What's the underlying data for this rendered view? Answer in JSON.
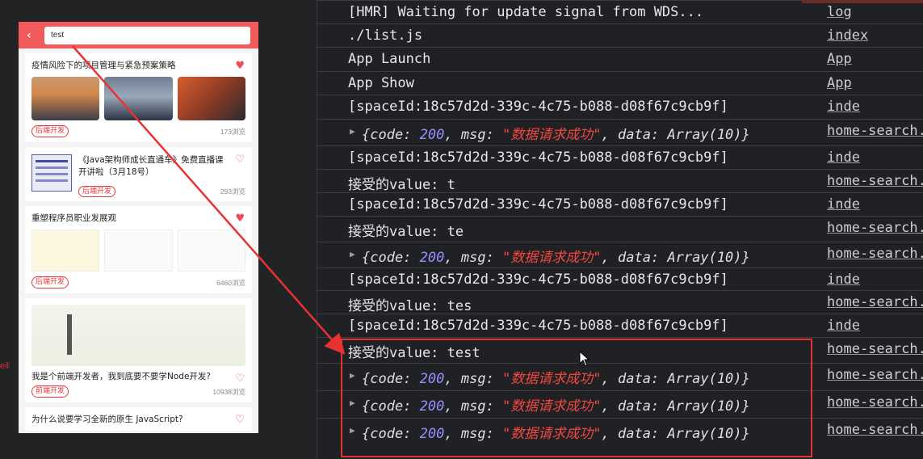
{
  "left_panel": {
    "stray_text": "eili",
    "search": {
      "back_icon": "‹",
      "query": "test"
    },
    "cards": [
      {
        "title": "疫情风险下的项目管理与紧急预案策略",
        "favorited": true,
        "tag": "后端开发",
        "views": "173浏览"
      },
      {
        "title": "《Java架构师成长直通车》免费直播课开讲啦（3月18号）",
        "favorited": false,
        "tag": "后端开发",
        "views": "293浏览"
      },
      {
        "title": "重塑程序员职业发展观",
        "favorited": true,
        "tag": "后端开发",
        "views": "6460浏览"
      },
      {
        "title": "我是个前端开发者，我到底要不要学Node开发?",
        "favorited": false,
        "tag": "前端开发",
        "views": "10938浏览"
      },
      {
        "title": "为什么说要学习全新的原生 JavaScript?",
        "favorited": false
      }
    ]
  },
  "console": {
    "lines": [
      {
        "message": "[HMR] Waiting for update signal from WDS...",
        "source": "log"
      },
      {
        "message": "./list.js",
        "source": "index"
      },
      {
        "message": "App Launch",
        "source": "App"
      },
      {
        "message": "App Show",
        "source": "App"
      },
      {
        "message": "[spaceId:18c57d2d-339c-4c75-b088-d08f67c9cb9f]",
        "source": "inde"
      },
      {
        "object": true,
        "source": "home-search."
      },
      {
        "message": "[spaceId:18c57d2d-339c-4c75-b088-d08f67c9cb9f]",
        "source": "inde"
      },
      {
        "message": "接受的value:  t",
        "source": "home-search."
      },
      {
        "message": "[spaceId:18c57d2d-339c-4c75-b088-d08f67c9cb9f]",
        "source": "inde"
      },
      {
        "message": "接受的value:  te",
        "source": "home-search."
      },
      {
        "object": true,
        "source": "home-search."
      },
      {
        "message": "[spaceId:18c57d2d-339c-4c75-b088-d08f67c9cb9f]",
        "source": "inde"
      },
      {
        "message": "接受的value:  tes",
        "source": "home-search."
      },
      {
        "message": "[spaceId:18c57d2d-339c-4c75-b088-d08f67c9cb9f]",
        "source": "inde"
      },
      {
        "message": "接受的value:  test",
        "source": "home-search."
      },
      {
        "object": true,
        "source": "home-search."
      },
      {
        "object": true,
        "source": "home-search."
      },
      {
        "object": true,
        "source": "home-search."
      }
    ],
    "object_preview": {
      "open": "{",
      "code_key": "code",
      "code_value": "200",
      "msg_key": "msg",
      "msg_value": "\"数据请求成功\"",
      "data_key": "data",
      "data_value": "Array(10)",
      "close": "}"
    }
  },
  "colors": {
    "accent_red": "#f05a5a",
    "highlight_red": "#e83232",
    "number_purple": "#9990ff",
    "string_red": "#f2473f"
  },
  "icons": [
    "back-arrow-icon",
    "heart-filled-icon",
    "heart-outline-icon",
    "expand-triangle-icon",
    "mouse-cursor-icon"
  ]
}
